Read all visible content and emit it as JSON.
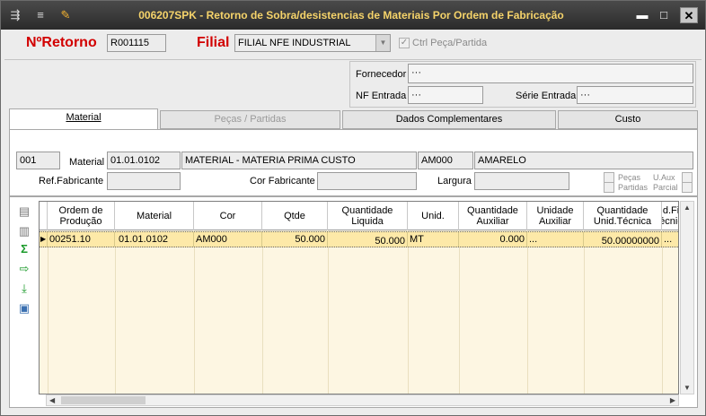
{
  "window": {
    "title": "006207SPK - Retorno de Sobra/desistencias de Materiais Por Ordem de Fabricação",
    "minimize": "▬",
    "maximize": "□",
    "close": "✕"
  },
  "header": {
    "nretorno_label": "NºRetorno",
    "nretorno_value": "R001115",
    "filial_label": "Filial",
    "filial_value": "FILIAL NFE INDUSTRIAL",
    "ctrl_label": "Ctrl Peça/Partida"
  },
  "supplier": {
    "fornecedor_label": "Fornecedor",
    "fornecedor_value": "···",
    "nf_label": "NF Entrada",
    "nf_value": "···",
    "serie_label": "Série Entrada",
    "serie_value": "···"
  },
  "tabs": [
    {
      "label": "Material"
    },
    {
      "label": "Peças / Partidas"
    },
    {
      "label": "Dados Complementares"
    },
    {
      "label": "Custo"
    }
  ],
  "material": {
    "seq": "001",
    "material_label": "Material",
    "material_code": "01.01.0102",
    "material_desc": "MATERIAL - MATERIA PRIMA CUSTO",
    "cor_code": "AM000",
    "cor_desc": "AMARELO",
    "ref_label": "Ref.Fabricante",
    "cor_fab_label": "Cor Fabricante",
    "largura_label": "Largura",
    "pecas_label_1": "Peças",
    "pecas_label_2": "Partidas",
    "uaux_label_1": "U.Aux",
    "uaux_label_2": "Parcial"
  },
  "grid": {
    "headers": [
      [
        "Ordem de",
        "Produção"
      ],
      [
        "Material",
        ""
      ],
      [
        "Cor",
        ""
      ],
      [
        "Qtde",
        ""
      ],
      [
        "Quantidade",
        "Liquida"
      ],
      [
        "Unid.",
        ""
      ],
      [
        "Quantidade",
        "Auxiliar"
      ],
      [
        "Unidade",
        "Auxiliar"
      ],
      [
        "Quantidade",
        "Unid.Técnica"
      ],
      [
        "d.Fi",
        "écnic"
      ]
    ],
    "rows": [
      [
        "00251.10",
        "01.01.0102",
        "AM000",
        "50.000",
        "50.000",
        "MT",
        "0.000",
        "...",
        "50.00000000",
        "..."
      ]
    ]
  },
  "tools": [
    "add-row-icon",
    "remove-row-icon",
    "sum-icon",
    "export-icon",
    "download-icon",
    "image-icon"
  ]
}
